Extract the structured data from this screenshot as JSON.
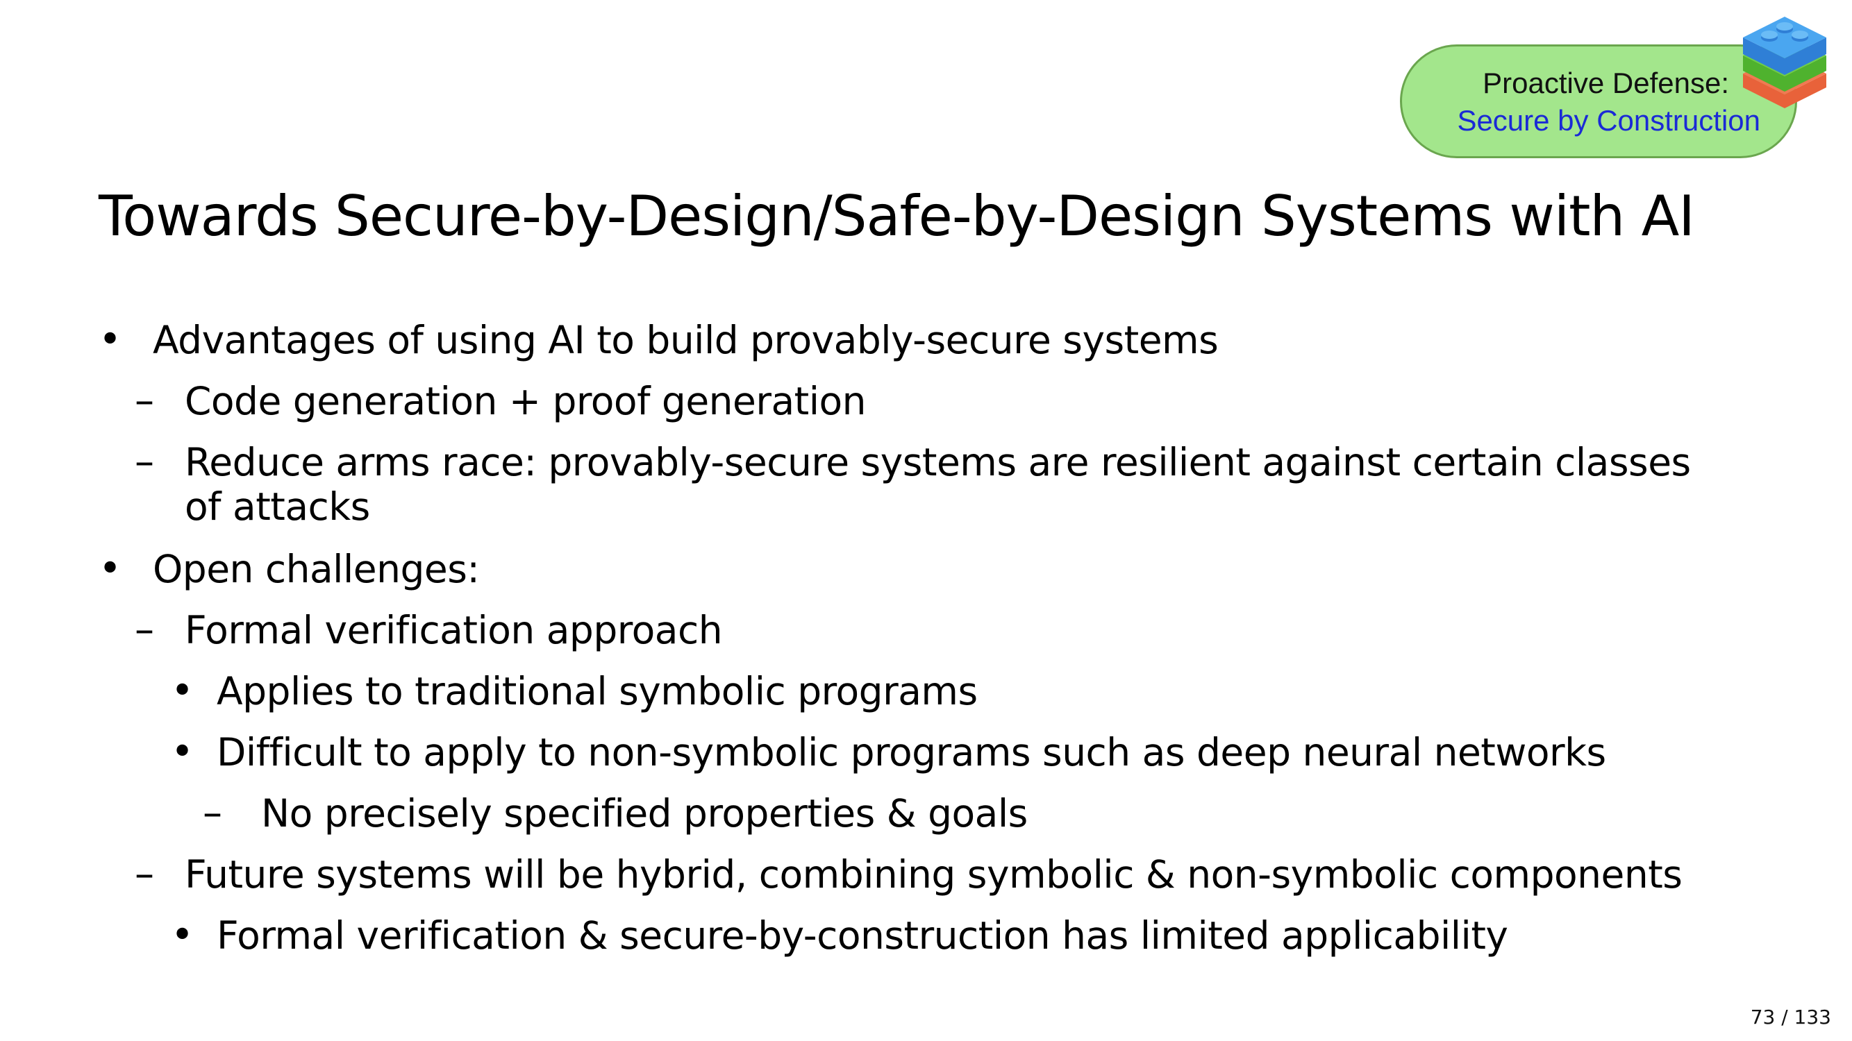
{
  "badge": {
    "line1": "Proactive Defense:",
    "line2": "Secure by Construction",
    "icon": "stacked-blocks-icon",
    "colors": {
      "background": "#a3e68c",
      "line2_text": "#1a2ad6",
      "block_top": "#3a8ee6",
      "block_middle": "#5cc23a",
      "block_bottom": "#e8623a"
    }
  },
  "slide": {
    "title": "Towards Secure-by-Design/Safe-by-Design Systems with AI",
    "bullets": [
      {
        "level": 1,
        "marker": "•",
        "text": "Advantages of using AI to build provably-secure systems"
      },
      {
        "level": 2,
        "marker": "–",
        "text": "Code generation + proof generation"
      },
      {
        "level": 2,
        "marker": "–",
        "text": "Reduce arms race: provably-secure systems are resilient against certain classes"
      },
      {
        "level": 2,
        "marker": "",
        "text": "of attacks"
      },
      {
        "level": 1,
        "marker": "•",
        "text": "Open challenges:"
      },
      {
        "level": 2,
        "marker": "–",
        "text": "Formal verification approach"
      },
      {
        "level": 3,
        "marker": "•",
        "text": "Applies to traditional symbolic programs"
      },
      {
        "level": 3,
        "marker": "•",
        "text": "Difficult to apply to non-symbolic programs such as deep neural networks"
      },
      {
        "level": 4,
        "marker": "–",
        "text": "No precisely specified properties & goals"
      },
      {
        "level": 2,
        "marker": "–",
        "text": "Future systems will be hybrid, combining symbolic & non-symbolic components"
      },
      {
        "level": 3,
        "marker": "•",
        "text": "Formal verification & secure-by-construction has limited applicability"
      }
    ]
  },
  "page": {
    "counter": "73 / 133"
  }
}
